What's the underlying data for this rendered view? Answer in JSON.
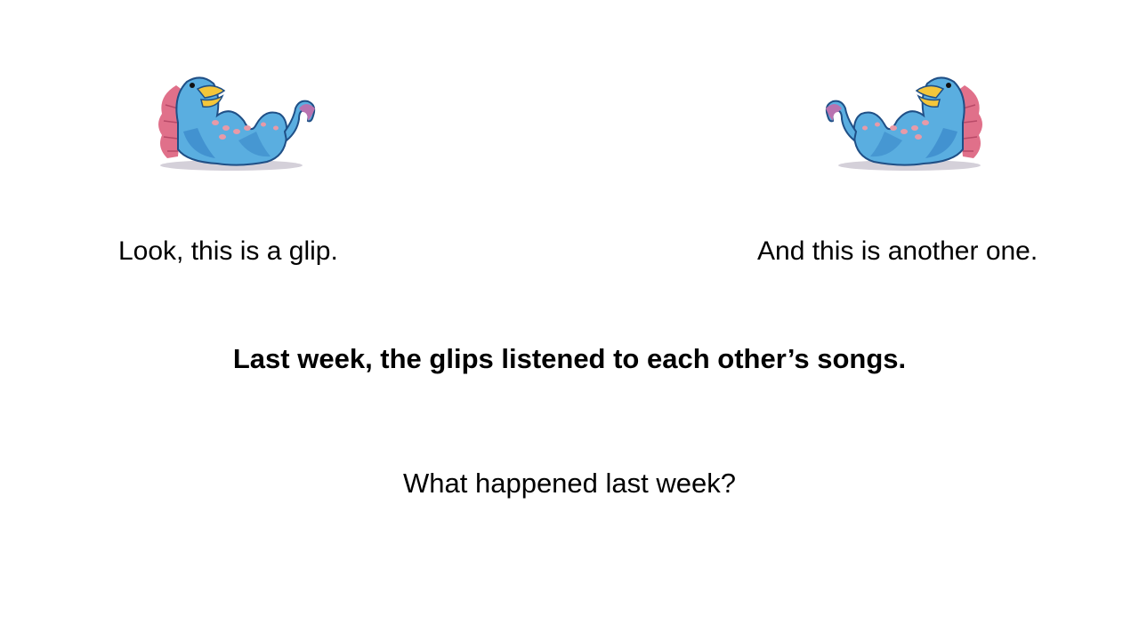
{
  "slide": {
    "left_caption": "Look, this is a glip.",
    "right_caption": "And this is another one.",
    "statement": "Last week, the glips listened to each other’s songs.",
    "question": "What happened last week?"
  },
  "illustration": {
    "left_creature": "glip-creature-icon",
    "right_creature": "glip-creature-icon",
    "colors": {
      "body": "#5aaee0",
      "body_shade": "#2f7cc2",
      "beak": "#f4c63a",
      "spots": "#e79aa8",
      "crest": "#e0708a",
      "shadow": "#c9c4cf"
    }
  }
}
